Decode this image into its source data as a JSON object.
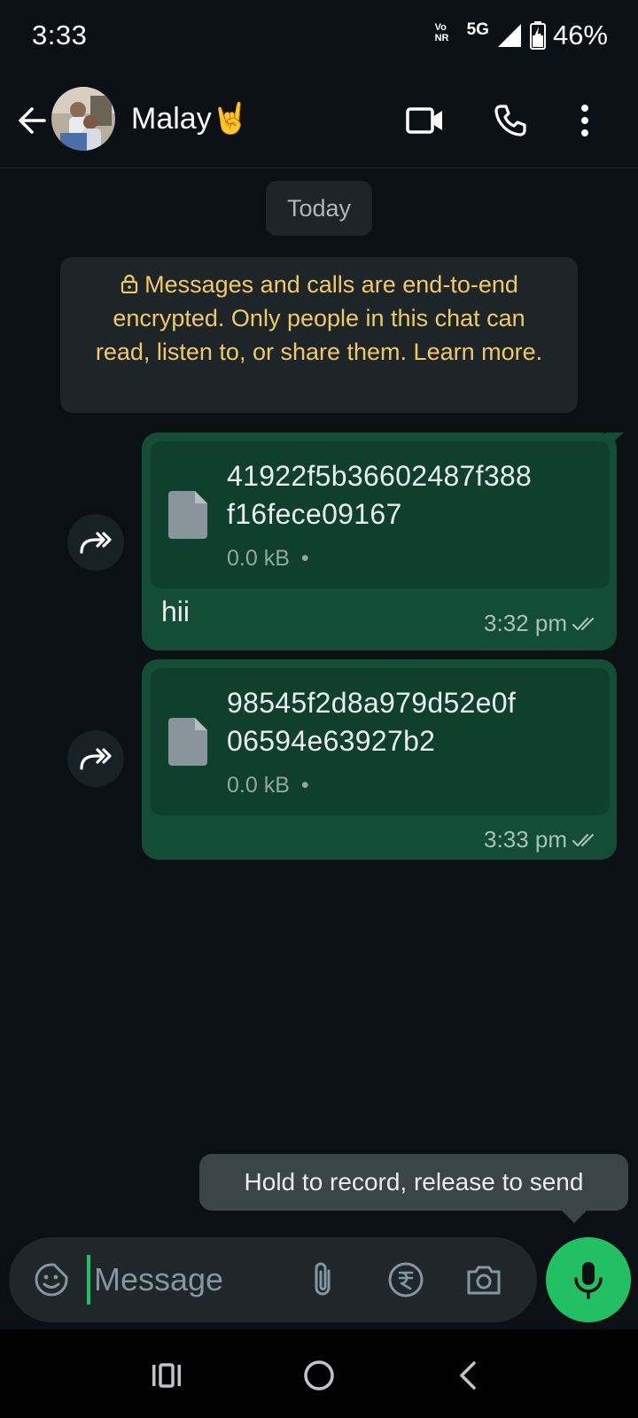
{
  "status_bar": {
    "time": "3:33",
    "volte_top": "Vo",
    "volte_bottom": "NR",
    "network": "5G",
    "battery": "46%"
  },
  "header": {
    "contact_name": "Malay",
    "contact_emoji": "🤘",
    "icons": [
      "back-arrow-icon",
      "video-call-icon",
      "voice-call-icon",
      "more-options-icon"
    ]
  },
  "conversation": {
    "date_label": "Today",
    "encryption_notice": "Messages and calls are end-to-end encrypted. Only people in this chat can read, listen to, or share them.",
    "learn_more": "Learn more.",
    "messages": [
      {
        "doc_name_line1": "41922f5b36602487f388",
        "doc_name_line2": "f16fece09167",
        "doc_size": "0.0 kB",
        "caption": "hii",
        "time": "3:32 pm",
        "status": "sent"
      },
      {
        "doc_name_line1": "98545f2d8a979d52e0f",
        "doc_name_line2": "06594e63927b2",
        "doc_size": "0.0 kB",
        "caption": "",
        "time": "3:33 pm",
        "status": "sent"
      }
    ]
  },
  "tooltip": {
    "text": "Hold to record, release to send"
  },
  "composer": {
    "placeholder": "Message",
    "value": ""
  },
  "colors": {
    "background": "#0b1014",
    "bubble_outgoing": "#134d37",
    "accent_green": "#21c063",
    "notice_text": "#f0c966"
  }
}
